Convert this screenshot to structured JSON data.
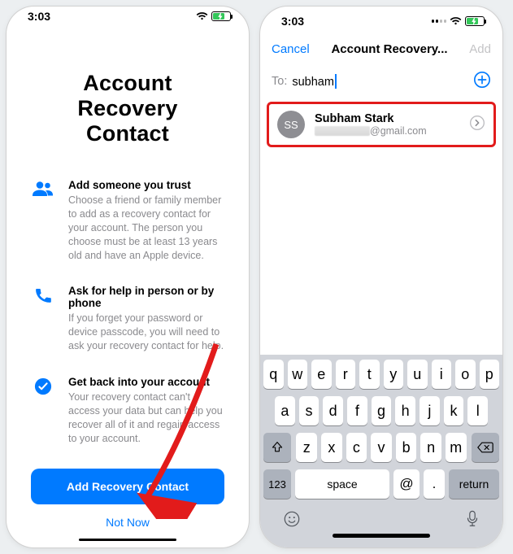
{
  "status": {
    "time": "3:03"
  },
  "left": {
    "title_l1": "Account Recovery",
    "title_l2": "Contact",
    "items": [
      {
        "heading": "Add someone you trust",
        "body": "Choose a friend or family member to add as a recovery contact for your account. The person you choose must be at least 13 years old and have an Apple device."
      },
      {
        "heading": "Ask for help in person or by phone",
        "body": "If you forget your password or device passcode, you will need to ask your recovery contact for help."
      },
      {
        "heading": "Get back into your account",
        "body": "Your recovery contact can't access your data but can help you recover all of it and regain access to your account."
      }
    ],
    "primary_btn": "Add Recovery Contact",
    "secondary_btn": "Not Now"
  },
  "right": {
    "nav": {
      "cancel": "Cancel",
      "title": "Account Recovery...",
      "add": "Add"
    },
    "to_label": "To:",
    "to_value": "subham",
    "contact": {
      "initials": "SS",
      "name": "Subham Stark",
      "email_suffix": "@gmail.com"
    },
    "keyboard": {
      "r1": [
        "q",
        "w",
        "e",
        "r",
        "t",
        "y",
        "u",
        "i",
        "o",
        "p"
      ],
      "r2": [
        "a",
        "s",
        "d",
        "f",
        "g",
        "h",
        "j",
        "k",
        "l"
      ],
      "r3": [
        "z",
        "x",
        "c",
        "v",
        "b",
        "n",
        "m"
      ],
      "sym": "123",
      "space": "space",
      "at": "@",
      "dot": ".",
      "ret": "return"
    }
  }
}
